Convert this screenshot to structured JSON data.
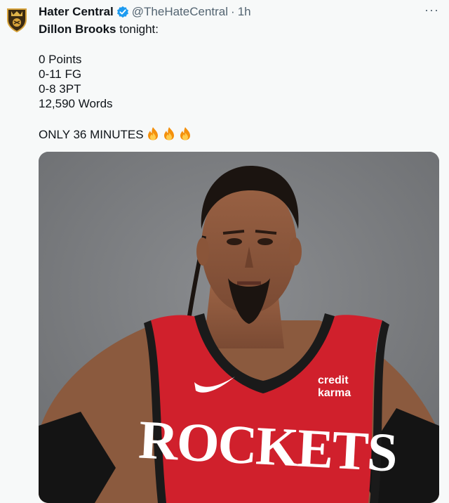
{
  "tweet": {
    "display_name": "Hater Central",
    "handle": "@TheHateCentral",
    "separator": "·",
    "time": "1h",
    "more_label": "···",
    "text": {
      "mention": "Dillon Brooks",
      "first_line_rest": " tonight:",
      "stats": [
        "0 Points",
        "0-11 FG",
        "0-8 3PT",
        "12,590 Words"
      ],
      "closing": "ONLY 36 MINUTES"
    },
    "emoji": [
      "fire",
      "fire",
      "fire"
    ]
  },
  "media": {
    "jersey_text": "ROCKETS",
    "sponsor_line1": "credit",
    "sponsor_line2": "karma",
    "jersey_color": "#d0202c",
    "background_color": "#7c7e81"
  },
  "colors": {
    "verified_blue": "#1d9bf0",
    "secondary_text": "#536471"
  }
}
